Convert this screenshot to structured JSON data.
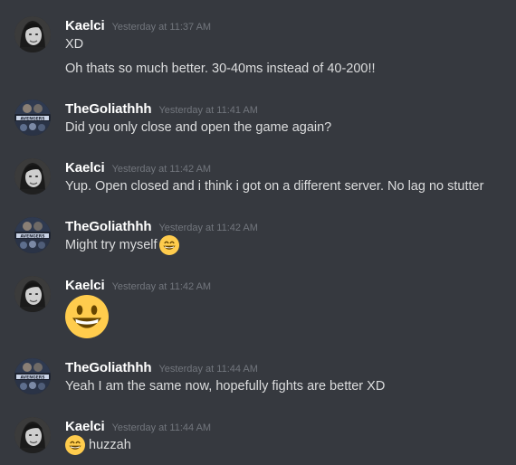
{
  "messages": [
    {
      "author": "Kaelci",
      "avatar": "kaelci-avatar",
      "timestamp": "Yesterday at 11:37 AM",
      "lines": [
        "XD",
        "Oh thats so much better. 30-40ms instead of 40-200!!"
      ]
    },
    {
      "author": "TheGoliathhh",
      "avatar": "thegoliathhh-avatar",
      "timestamp": "Yesterday at 11:41 AM",
      "lines": [
        "Did you only close and open the game again?"
      ]
    },
    {
      "author": "Kaelci",
      "avatar": "kaelci-avatar",
      "timestamp": "Yesterday at 11:42 AM",
      "lines": [
        "Yup. Open closed and i think i got on a different server. No lag no stutter"
      ]
    },
    {
      "author": "TheGoliathhh",
      "avatar": "thegoliathhh-avatar",
      "timestamp": "Yesterday at 11:42 AM",
      "lines": [
        "Might try myself"
      ],
      "trailing_emoji": "smile-emoji"
    },
    {
      "author": "Kaelci",
      "avatar": "kaelci-avatar",
      "timestamp": "Yesterday at 11:42 AM",
      "big_emoji": "smiley-emoji"
    },
    {
      "author": "TheGoliathhh",
      "avatar": "thegoliathhh-avatar",
      "timestamp": "Yesterday at 11:44 AM",
      "lines": [
        "Yeah I am the same now, hopefully fights are better XD"
      ]
    },
    {
      "author": "Kaelci",
      "avatar": "kaelci-avatar",
      "timestamp": "Yesterday at 11:44 AM",
      "leading_emoji": "smile-emoji",
      "lines": [
        "huzzah"
      ]
    }
  ],
  "colors": {
    "background": "#36393f",
    "username": "#ffffff",
    "timestamp": "#72767d",
    "text": "#dcddde",
    "emoji": "#ffcc4d"
  }
}
